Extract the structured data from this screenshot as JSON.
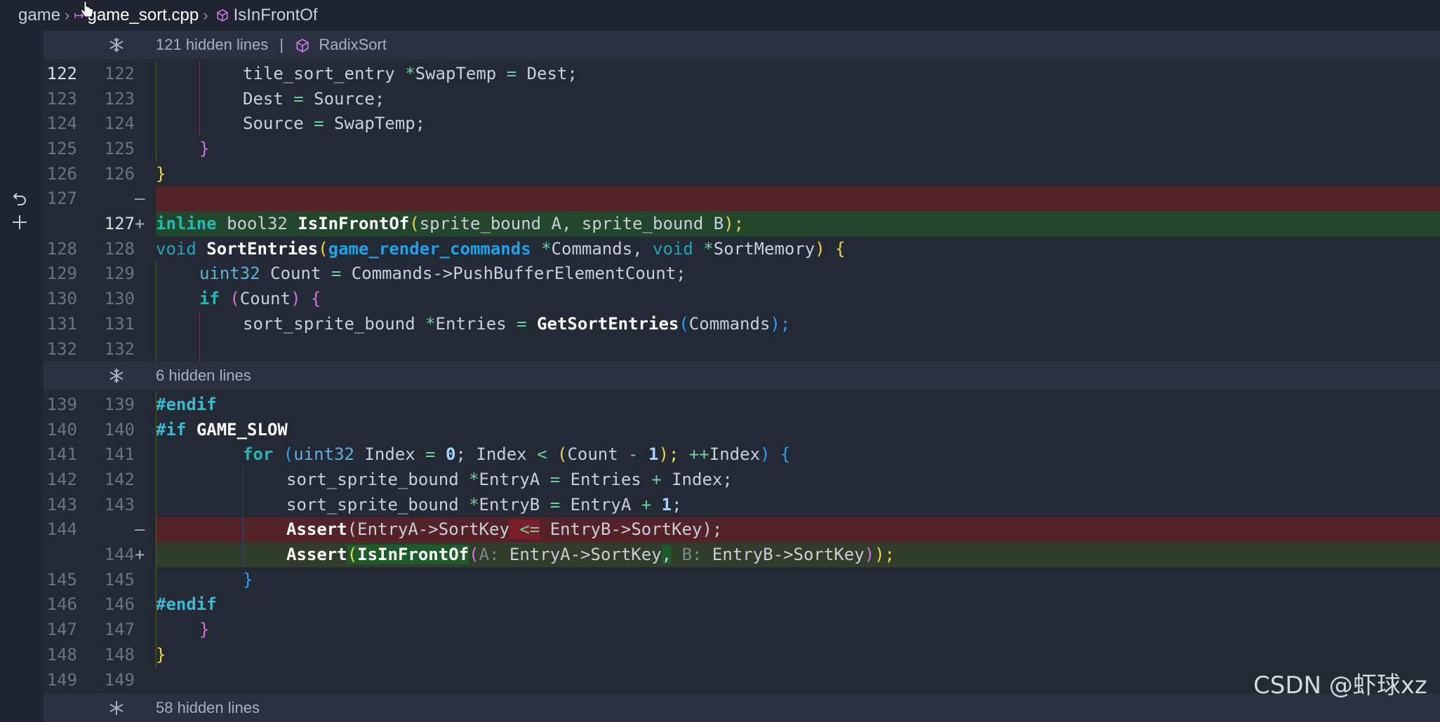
{
  "breadcrumb": {
    "folder": "game",
    "file": "game_sort.cpp",
    "symbol": "IsInFrontOf"
  },
  "hidden_regions": [
    {
      "label": "121 hidden lines",
      "context": "RadixSort"
    },
    {
      "label": "6 hidden lines",
      "context": ""
    },
    {
      "label": "58 hidden lines",
      "context": ""
    }
  ],
  "lines": [
    {
      "old": "122",
      "new": "122",
      "mark": ""
    },
    {
      "old": "123",
      "new": "123",
      "mark": ""
    },
    {
      "old": "124",
      "new": "124",
      "mark": ""
    },
    {
      "old": "125",
      "new": "125",
      "mark": ""
    },
    {
      "old": "126",
      "new": "126",
      "mark": ""
    },
    {
      "old": "127",
      "new": "",
      "mark": "–"
    },
    {
      "old": "",
      "new": "127",
      "mark": "+"
    },
    {
      "old": "128",
      "new": "128",
      "mark": ""
    },
    {
      "old": "129",
      "new": "129",
      "mark": ""
    },
    {
      "old": "130",
      "new": "130",
      "mark": ""
    },
    {
      "old": "131",
      "new": "131",
      "mark": ""
    },
    {
      "old": "132",
      "new": "132",
      "mark": ""
    },
    {
      "old": "139",
      "new": "139",
      "mark": ""
    },
    {
      "old": "140",
      "new": "140",
      "mark": ""
    },
    {
      "old": "141",
      "new": "141",
      "mark": ""
    },
    {
      "old": "142",
      "new": "142",
      "mark": ""
    },
    {
      "old": "143",
      "new": "143",
      "mark": ""
    },
    {
      "old": "144",
      "new": "",
      "mark": "–"
    },
    {
      "old": "",
      "new": "144",
      "mark": "+"
    },
    {
      "old": "145",
      "new": "145",
      "mark": ""
    },
    {
      "old": "146",
      "new": "146",
      "mark": ""
    },
    {
      "old": "147",
      "new": "147",
      "mark": ""
    },
    {
      "old": "148",
      "new": "148",
      "mark": ""
    },
    {
      "old": "149",
      "new": "149",
      "mark": ""
    }
  ],
  "code": {
    "l122": [
      "tile_sort_entry ",
      "*",
      "SwapTemp ",
      "=",
      " Dest;"
    ],
    "l123": [
      "Dest ",
      "=",
      " Source;"
    ],
    "l124": [
      "Source ",
      "=",
      " SwapTemp;"
    ],
    "l125": "}",
    "l126": "}",
    "l127add": [
      "inline",
      " bool32 ",
      "IsInFrontOf",
      "(",
      "sprite_bound A, sprite_bound B",
      ");"
    ],
    "l128": [
      "void",
      " ",
      "SortEntries",
      "(",
      "game_render_commands",
      " ",
      "*",
      "Commands, ",
      "void",
      " ",
      "*",
      "SortMemory",
      ")",
      " {"
    ],
    "l129": [
      "uint32",
      " Count ",
      "=",
      " Commands->PushBufferElementCount;"
    ],
    "l130": [
      "if",
      " (",
      "Count",
      ")",
      " {"
    ],
    "l131": [
      "sort_sprite_bound ",
      "*",
      "Entries ",
      "=",
      " ",
      "GetSortEntries",
      "(",
      "Commands",
      ");"
    ],
    "l139": "#endif",
    "l140": [
      "#if",
      " ",
      "GAME_SLOW"
    ],
    "l141": [
      "for",
      " (",
      "uint32",
      " Index ",
      "=",
      " ",
      "0",
      "; Index ",
      "<",
      " (",
      "Count ",
      "-",
      " ",
      "1",
      "); ",
      "++",
      "Index",
      ")",
      " {"
    ],
    "l142": [
      "sort_sprite_bound ",
      "*",
      "EntryA ",
      "=",
      " Entries ",
      "+",
      " Index;"
    ],
    "l143": [
      "sort_sprite_bound ",
      "*",
      "EntryB ",
      "=",
      " EntryA ",
      "+",
      " ",
      "1",
      ";"
    ],
    "l144del": [
      "Assert",
      "(",
      "EntryA->SortKey",
      " ",
      "<=",
      " ",
      "EntryB->SortKey",
      ");"
    ],
    "l144add": [
      "Assert",
      "(",
      "IsInFrontOf",
      "(",
      "A:",
      " EntryA->SortKey",
      ",",
      " ",
      "B:",
      " EntryB->SortKey",
      ")",
      ");"
    ],
    "l145": "}",
    "l146": "#endif",
    "l147": "}",
    "l148": "}"
  },
  "watermark": "CSDN @虾球xz",
  "colors": {
    "editor_bg": "#242936",
    "deleted_line": "#542329",
    "added_line": "#23472c",
    "keyword": "#24b8b8",
    "type": "#1fa2e8"
  }
}
